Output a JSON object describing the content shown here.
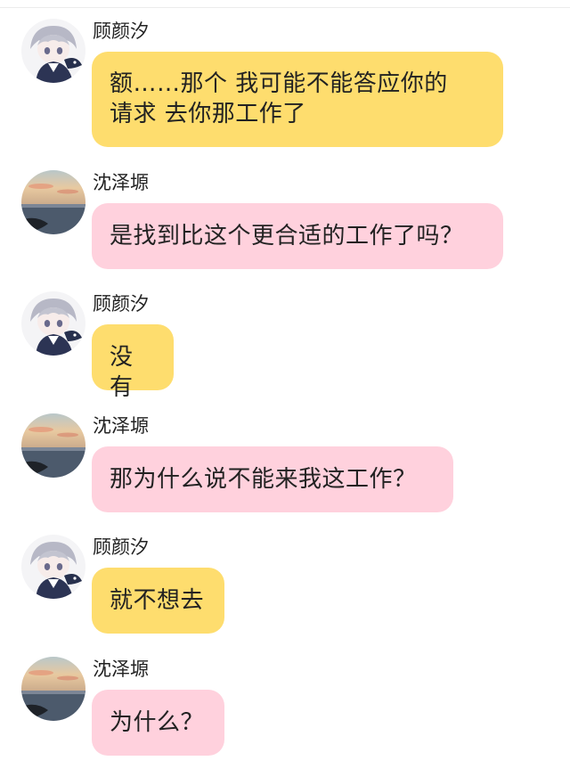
{
  "colors": {
    "yellow_bubble": "#fedd6e",
    "pink_bubble": "#ffd1dd"
  },
  "messages": [
    {
      "sender": "顾颜汐",
      "text": "额……那个 我可能不能答应你的\n请求 去你那工作了",
      "avatar": "anime-boy-avatar-icon"
    },
    {
      "sender": "沈泽塬",
      "text": "是找到比这个更合适的工作了吗？",
      "avatar": "sunset-sea-avatar-icon"
    },
    {
      "sender": "顾颜汐",
      "text": "没有",
      "avatar": "anime-boy-avatar-icon"
    },
    {
      "sender": "沈泽塬",
      "text": "那为什么说不能来我这工作？",
      "avatar": "sunset-sea-avatar-icon"
    },
    {
      "sender": "顾颜汐",
      "text": "就不想去",
      "avatar": "anime-boy-avatar-icon"
    },
    {
      "sender": "沈泽塬",
      "text": "为什么？",
      "avatar": "sunset-sea-avatar-icon"
    }
  ]
}
